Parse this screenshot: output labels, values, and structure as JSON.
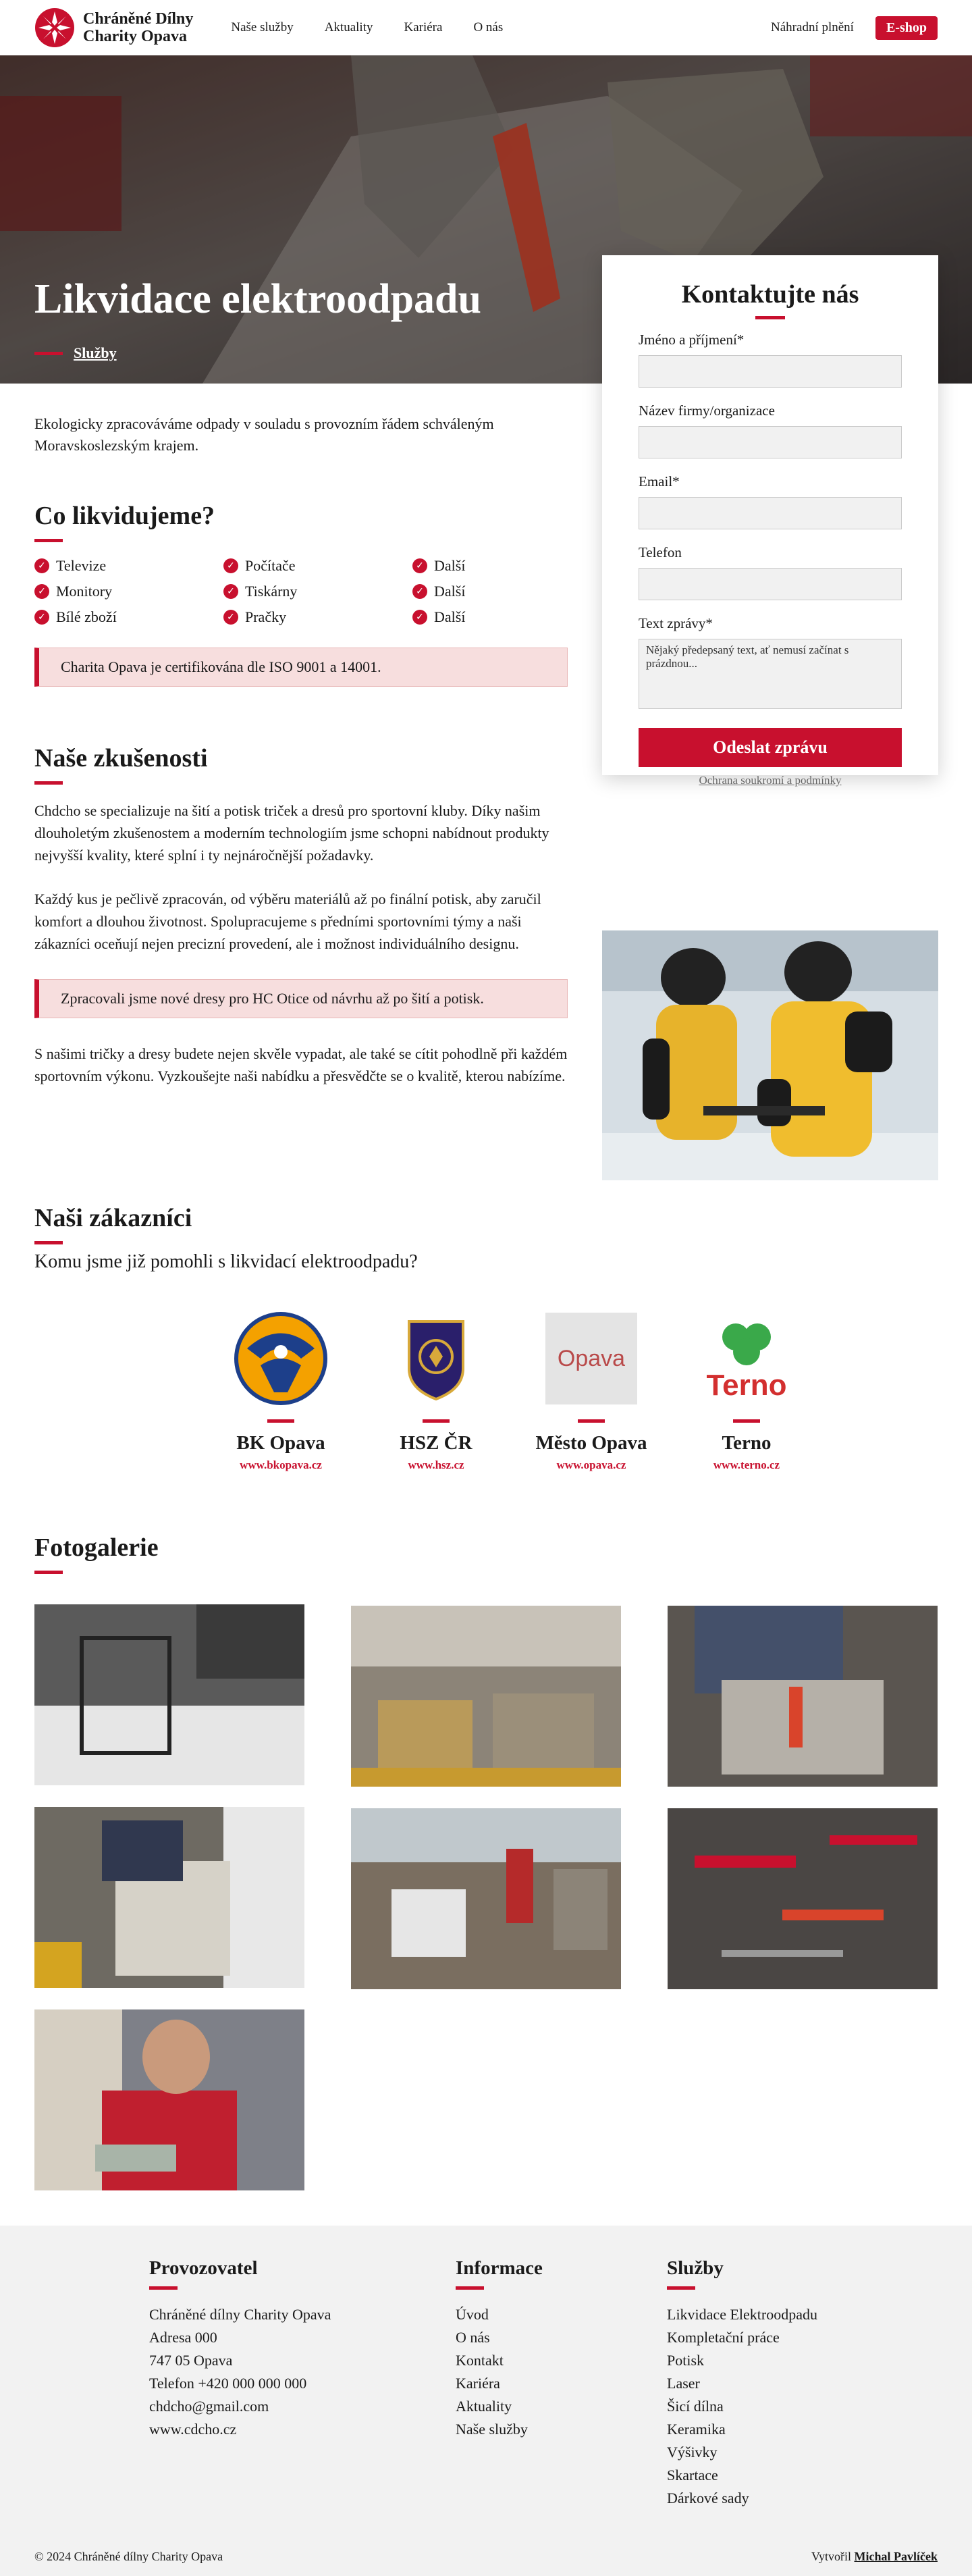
{
  "header": {
    "logo_line1": "Chráněné Dílny",
    "logo_line2": "Charity Opava",
    "nav": [
      "Naše služby",
      "Aktuality",
      "Kariéra",
      "O nás"
    ],
    "nahradni": "Náhradní plnění",
    "eshop": "E-shop"
  },
  "hero": {
    "title": "Likvidace elektroodpadu",
    "crumb": "Služby"
  },
  "contact": {
    "title": "Kontaktujte nás",
    "name_label": "Jméno a příjmení*",
    "company_label": "Název firmy/organizace",
    "email_label": "Email*",
    "phone_label": "Telefon",
    "message_label": "Text zprávy*",
    "message_placeholder": "Nějaký předepsaný text, ať nemusí začínat s prázdnou...",
    "submit": "Odeslat zprávu",
    "privacy": "Ochrana soukromí a podmínky"
  },
  "intro": "Ekologicky zpracováváme odpady v souladu s provozním řádem schváleným Moravskoslezským krajem.",
  "what": {
    "title": "Co likvidujeme?",
    "items": [
      "Televize",
      "Počítače",
      "Další",
      "Monitory",
      "Tiskárny",
      "Další",
      "Bílé zboží",
      "Pračky",
      "Další"
    ],
    "callout": "Charita Opava je certifikována dle ISO 9001 a 14001."
  },
  "experience": {
    "title": "Naše zkušenosti",
    "p1": "Chdcho se specializuje na šití a potisk triček a dresů pro sportovní kluby. Díky našim dlouholetým zkušenostem a moderním technologiím jsme schopni nabídnout produkty nejvyšší kvality, které splní i ty nejnáročnější požadavky.",
    "p2": "Každý kus je pečlivě zpracován, od výběru materiálů až po finální potisk, aby zaručil komfort a dlouhou životnost. Spolupracujeme s předními sportovními týmy a naši zákazníci oceňují nejen precizní provedení, ale i možnost individuálního designu.",
    "callout": "Zpracovali jsme nové dresy pro HC Otice od návrhu až po šití a potisk.",
    "p3": "S našimi tričky a dresy budete nejen skvěle vypadat, ale také se cítit pohodlně při každém sportovním výkonu. Vyzkoušejte naši nabídku a přesvědčte se o kvalitě, kterou nabízíme."
  },
  "customers": {
    "title": "Naši zákazníci",
    "subtitle": "Komu jsme již pomohli s likvidací elektroodpadu?",
    "list": [
      {
        "name": "BK Opava",
        "url": "www.bkopava.cz"
      },
      {
        "name": "HSZ ČR",
        "url": "www.hsz.cz"
      },
      {
        "name": "Město Opava",
        "url": "www.opava.cz"
      },
      {
        "name": "Terno",
        "url": "www.terno.cz"
      }
    ],
    "opava_logo_text": "Opava",
    "terno_logo_text": "Terno"
  },
  "gallery": {
    "title": "Fotogalerie"
  },
  "footer": {
    "provozovatel": {
      "title": "Provozovatel",
      "lines": [
        "Chráněné dílny Charity Opava",
        "Adresa 000",
        "747 05 Opava",
        "Telefon +420 000 000 000",
        "chdcho@gmail.com",
        "www.cdcho.cz"
      ]
    },
    "informace": {
      "title": "Informace",
      "lines": [
        "Úvod",
        "O nás",
        "Kontakt",
        "Kariéra",
        "Aktuality",
        "Naše služby"
      ]
    },
    "sluzby": {
      "title": "Služby",
      "lines": [
        "Likvidace Elektroodpadu",
        "Kompletační práce",
        "Potisk",
        "Laser",
        "Šicí dílna",
        "Keramika",
        "Výšivky",
        "Skartace",
        "Dárkové sady"
      ]
    },
    "copyright": "© 2024 Chráněné dílny Charity Opava",
    "credit_prefix": "Vytvořil",
    "credit_name": "Michal Pavlíček"
  },
  "colors": {
    "accent": "#c8102e",
    "callout_bg": "#f7dede",
    "footer_bg": "#f2f2f2"
  }
}
